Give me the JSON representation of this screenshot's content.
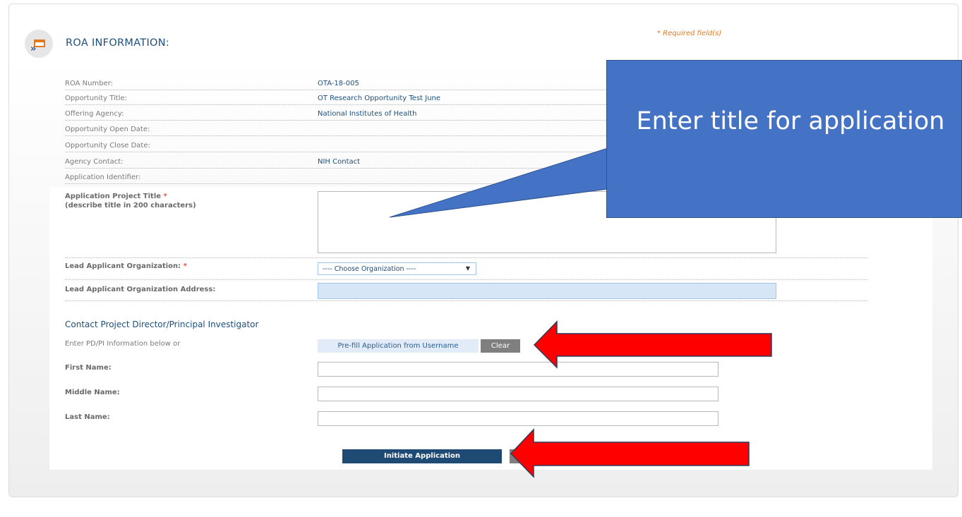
{
  "header": {
    "section_title": "ROA INFORMATION:",
    "required_note": "* Required field(s)",
    "icon": "window-arrow-icon"
  },
  "info_rows": [
    {
      "label": "ROA Number:",
      "value": "OTA-18-005"
    },
    {
      "label": "Opportunity Title:",
      "value": "OT Research Opportunity Test June"
    },
    {
      "label": "Offering Agency:",
      "value": "National Institutes of Health"
    },
    {
      "label": "Opportunity Open Date:",
      "value": ""
    },
    {
      "label": "Opportunity Close Date:",
      "value": ""
    },
    {
      "label": "Agency Contact:",
      "value": "NIH Contact"
    },
    {
      "label": "Application Identifier:",
      "value": ""
    }
  ],
  "form": {
    "project_title_label": "Application Project Title",
    "project_title_hint": "(describe title in 200 characters)",
    "required_marker": "*",
    "project_title_value": "",
    "lead_org_label": "Lead Applicant Organization:",
    "lead_org_selected": "---- Choose Organization ----",
    "lead_org_address_label": "Lead Applicant Organization Address:",
    "lead_org_address_value": ""
  },
  "contact": {
    "heading": "Contact Project Director/Principal Investigator",
    "note": "Enter PD/PI Information below or",
    "prefill_button": "Pre-fill Application from Username",
    "clear_button": "Clear",
    "first_name_label": "First Name:",
    "middle_name_label": "Middle Name:",
    "last_name_label": "Last Name:",
    "first_name_value": "",
    "middle_name_value": "",
    "last_name_value": ""
  },
  "actions": {
    "initiate_button": "Initiate Application"
  },
  "annotations": {
    "callout_text": "Enter title for application",
    "callout_color": "#4472C4",
    "arrow_color": "#FF0000"
  }
}
